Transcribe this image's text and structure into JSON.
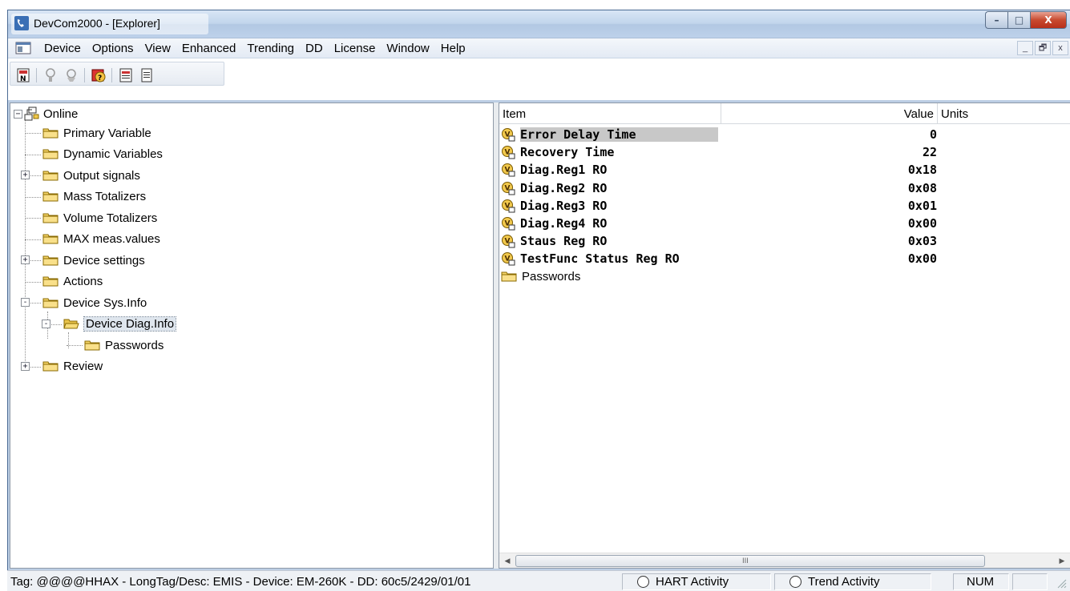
{
  "window": {
    "title": "DevCom2000 - [Explorer]",
    "caption_buttons": {
      "minimize": "–",
      "maximize": "□",
      "close": "X"
    }
  },
  "menu": {
    "items": [
      "Device",
      "Options",
      "View",
      "Enhanced",
      "Trending",
      "DD",
      "License",
      "Window",
      "Help"
    ],
    "mdi_buttons": [
      "_",
      "🗗",
      "x"
    ]
  },
  "toolbar": {
    "buttons": [
      "connect-icon",
      "probe-icon",
      "probe2-icon",
      "help-icon",
      "report-icon",
      "document-icon"
    ]
  },
  "tree": {
    "root": "Online",
    "items": [
      {
        "label": "Primary Variable",
        "expander": ""
      },
      {
        "label": "Dynamic Variables",
        "expander": ""
      },
      {
        "label": "Output signals",
        "expander": "+"
      },
      {
        "label": "Mass Totalizers",
        "expander": ""
      },
      {
        "label": "Volume Totalizers",
        "expander": ""
      },
      {
        "label": "MAX meas.values",
        "expander": ""
      },
      {
        "label": "Device settings",
        "expander": "+"
      },
      {
        "label": "Actions",
        "expander": ""
      },
      {
        "label": "Device Sys.Info",
        "expander": "-"
      },
      {
        "label": "Device Diag.Info",
        "expander": "-"
      },
      {
        "label": "Passwords",
        "expander": ""
      },
      {
        "label": "Review",
        "expander": "+"
      }
    ]
  },
  "list": {
    "columns": {
      "item": "Item",
      "value": "Value",
      "units": "Units"
    },
    "rows": [
      {
        "name": "Error Delay Time",
        "value": "0"
      },
      {
        "name": "Recovery Time",
        "value": "22"
      },
      {
        "name": "Diag.Reg1 RO",
        "value": "0x18"
      },
      {
        "name": "Diag.Reg2 RO",
        "value": "0x08"
      },
      {
        "name": "Diag.Reg3 RO",
        "value": "0x01"
      },
      {
        "name": "Diag.Reg4 RO",
        "value": "0x00"
      },
      {
        "name": "Staus Reg RO",
        "value": "0x03"
      },
      {
        "name": "TestFunc Status Reg RO",
        "value": "0x00"
      }
    ],
    "folder_item": "Passwords",
    "scroll_grip": "III"
  },
  "status": {
    "tag": "Tag: @@@@HHAX - LongTag/Desc: EMIS - Device: EM-260K - DD: 60c5/2429/01/01",
    "hart": "HART Activity",
    "trend": "Trend Activity",
    "num": "NUM"
  }
}
